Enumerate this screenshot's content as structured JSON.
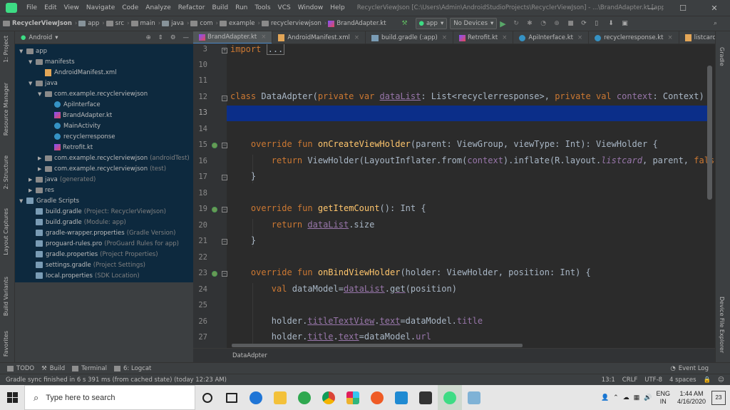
{
  "menubar": {
    "items": [
      "File",
      "Edit",
      "View",
      "Navigate",
      "Code",
      "Analyze",
      "Refactor",
      "Build",
      "Run",
      "Tools",
      "VCS",
      "Window",
      "Help"
    ],
    "title": "RecyclerViewJson [C:\\Users\\Admin\\AndroidStudioProjects\\RecyclerViewJson] - ...\\BrandAdapter.kt [app]"
  },
  "navbar": {
    "crumbs": [
      "RecyclerViewJson",
      "app",
      "src",
      "main",
      "java",
      "com",
      "example",
      "recyclerviewjson",
      "BrandAdapter.kt"
    ],
    "run_config": "app",
    "device": "No Devices"
  },
  "project": {
    "view_mode": "Android",
    "tree": [
      {
        "label": "app",
        "sub": "",
        "depth": 0,
        "arrow": "▼",
        "kind": "folder"
      },
      {
        "label": "manifests",
        "sub": "",
        "depth": 1,
        "arrow": "▼",
        "kind": "folder"
      },
      {
        "label": "AndroidManifest.xml",
        "sub": "",
        "depth": 2,
        "arrow": "",
        "kind": "xml"
      },
      {
        "label": "java",
        "sub": "",
        "depth": 1,
        "arrow": "▼",
        "kind": "folder"
      },
      {
        "label": "com.example.recyclerviewjson",
        "sub": "",
        "depth": 2,
        "arrow": "▼",
        "kind": "folder"
      },
      {
        "label": "ApiInterface",
        "sub": "",
        "depth": 3,
        "arrow": "",
        "kind": "class"
      },
      {
        "label": "BrandAdapter.kt",
        "sub": "",
        "depth": 3,
        "arrow": "",
        "kind": "kotlin"
      },
      {
        "label": "MainActivity",
        "sub": "",
        "depth": 3,
        "arrow": "",
        "kind": "class"
      },
      {
        "label": "recyclerresponse",
        "sub": "",
        "depth": 3,
        "arrow": "",
        "kind": "class"
      },
      {
        "label": "Retrofit.kt",
        "sub": "",
        "depth": 3,
        "arrow": "",
        "kind": "kotlin"
      },
      {
        "label": "com.example.recyclerviewjson",
        "sub": "(androidTest)",
        "depth": 2,
        "arrow": "▶",
        "kind": "folder"
      },
      {
        "label": "com.example.recyclerviewjson",
        "sub": "(test)",
        "depth": 2,
        "arrow": "▶",
        "kind": "folder"
      },
      {
        "label": "java",
        "sub": "(generated)",
        "depth": 1,
        "arrow": "▶",
        "kind": "folder"
      },
      {
        "label": "res",
        "sub": "",
        "depth": 1,
        "arrow": "▶",
        "kind": "folder"
      },
      {
        "label": "Gradle Scripts",
        "sub": "",
        "depth": 0,
        "arrow": "▼",
        "kind": "gradle"
      },
      {
        "label": "build.gradle",
        "sub": "(Project: RecyclerViewJson)",
        "depth": 1,
        "arrow": "",
        "kind": "gradle"
      },
      {
        "label": "build.gradle",
        "sub": "(Module: app)",
        "depth": 1,
        "arrow": "",
        "kind": "gradle"
      },
      {
        "label": "gradle-wrapper.properties",
        "sub": "(Gradle Version)",
        "depth": 1,
        "arrow": "",
        "kind": "gradle"
      },
      {
        "label": "proguard-rules.pro",
        "sub": "(ProGuard Rules for app)",
        "depth": 1,
        "arrow": "",
        "kind": "gradle"
      },
      {
        "label": "gradle.properties",
        "sub": "(Project Properties)",
        "depth": 1,
        "arrow": "",
        "kind": "gradle"
      },
      {
        "label": "settings.gradle",
        "sub": "(Project Settings)",
        "depth": 1,
        "arrow": "",
        "kind": "gradle"
      },
      {
        "label": "local.properties",
        "sub": "(SDK Location)",
        "depth": 1,
        "arrow": "",
        "kind": "gradle"
      }
    ]
  },
  "left_tabs": [
    "1: Project",
    "Resource Manager",
    "2: Structure",
    "Layout Captures",
    "Build Variants",
    "Favorites"
  ],
  "right_tabs": [
    "Gradle",
    "Device File Explorer"
  ],
  "tabs": [
    {
      "label": "BrandAdapter.kt",
      "active": true
    },
    {
      "label": "AndroidManifest.xml",
      "active": false
    },
    {
      "label": "build.gradle (:app)",
      "active": false
    },
    {
      "label": "Retrofit.kt",
      "active": false
    },
    {
      "label": "ApiInterface.kt",
      "active": false
    },
    {
      "label": "recyclerresponse.kt",
      "active": false
    },
    {
      "label": "listcard.xml",
      "active": false
    }
  ],
  "editor": {
    "line_numbers": [
      "3",
      "10",
      "11",
      "12",
      "13",
      "14",
      "15",
      "16",
      "17",
      "18",
      "19",
      "20",
      "21",
      "22",
      "23",
      "24",
      "25",
      "26",
      "27"
    ],
    "breadcrumb": "DataAdpter"
  },
  "toolwindows": [
    "TODO",
    "Build",
    "Terminal",
    "6: Logcat"
  ],
  "event_log": "Event Log",
  "status": {
    "message": "Gradle sync finished in 6 s 391 ms (from cached state) (today 12:23 AM)",
    "position": "13:1",
    "line_sep": "CRLF",
    "encoding": "UTF-8",
    "indent": "4 spaces"
  },
  "taskbar": {
    "search_placeholder": "Type here to search",
    "lang": "ENG",
    "region": "IN",
    "time": "1:44 AM",
    "date": "4/16/2020",
    "notifications": "23"
  }
}
